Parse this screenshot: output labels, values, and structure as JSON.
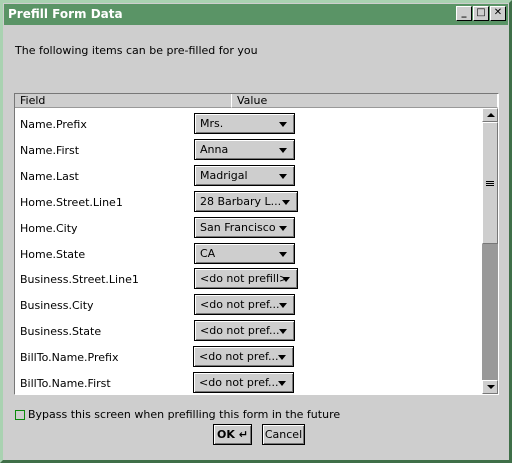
{
  "window": {
    "title": "Prefill Form Data",
    "minimize": "_",
    "maximize": "□",
    "close": "✕"
  },
  "intro": "The following items can be pre-filled for you",
  "table": {
    "headers": [
      "Field",
      "Value"
    ],
    "rows": [
      {
        "field": "Name.Prefix",
        "value": "Mrs."
      },
      {
        "field": "Name.First",
        "value": "Anna"
      },
      {
        "field": "Name.Last",
        "value": "Madrigal"
      },
      {
        "field": "Home.Street.Line1",
        "value": "28 Barbary L..."
      },
      {
        "field": "Home.City",
        "value": "San Francisco"
      },
      {
        "field": "Home.State",
        "value": "CA"
      },
      {
        "field": "Business.Street.Line1",
        "value": "<do not prefill>"
      },
      {
        "field": "Business.City",
        "value": "<do not pref..."
      },
      {
        "field": "Business.State",
        "value": "<do not pref..."
      },
      {
        "field": "BillTo.Name.Prefix",
        "value": "<do not pref..."
      },
      {
        "field": "BillTo.Name.First",
        "value": "<do not pref..."
      }
    ]
  },
  "bypass_label": "Bypass this screen when prefilling this form in the future",
  "bypass_checked": false,
  "buttons": {
    "ok": "OK ↵",
    "cancel": "Cancel"
  }
}
